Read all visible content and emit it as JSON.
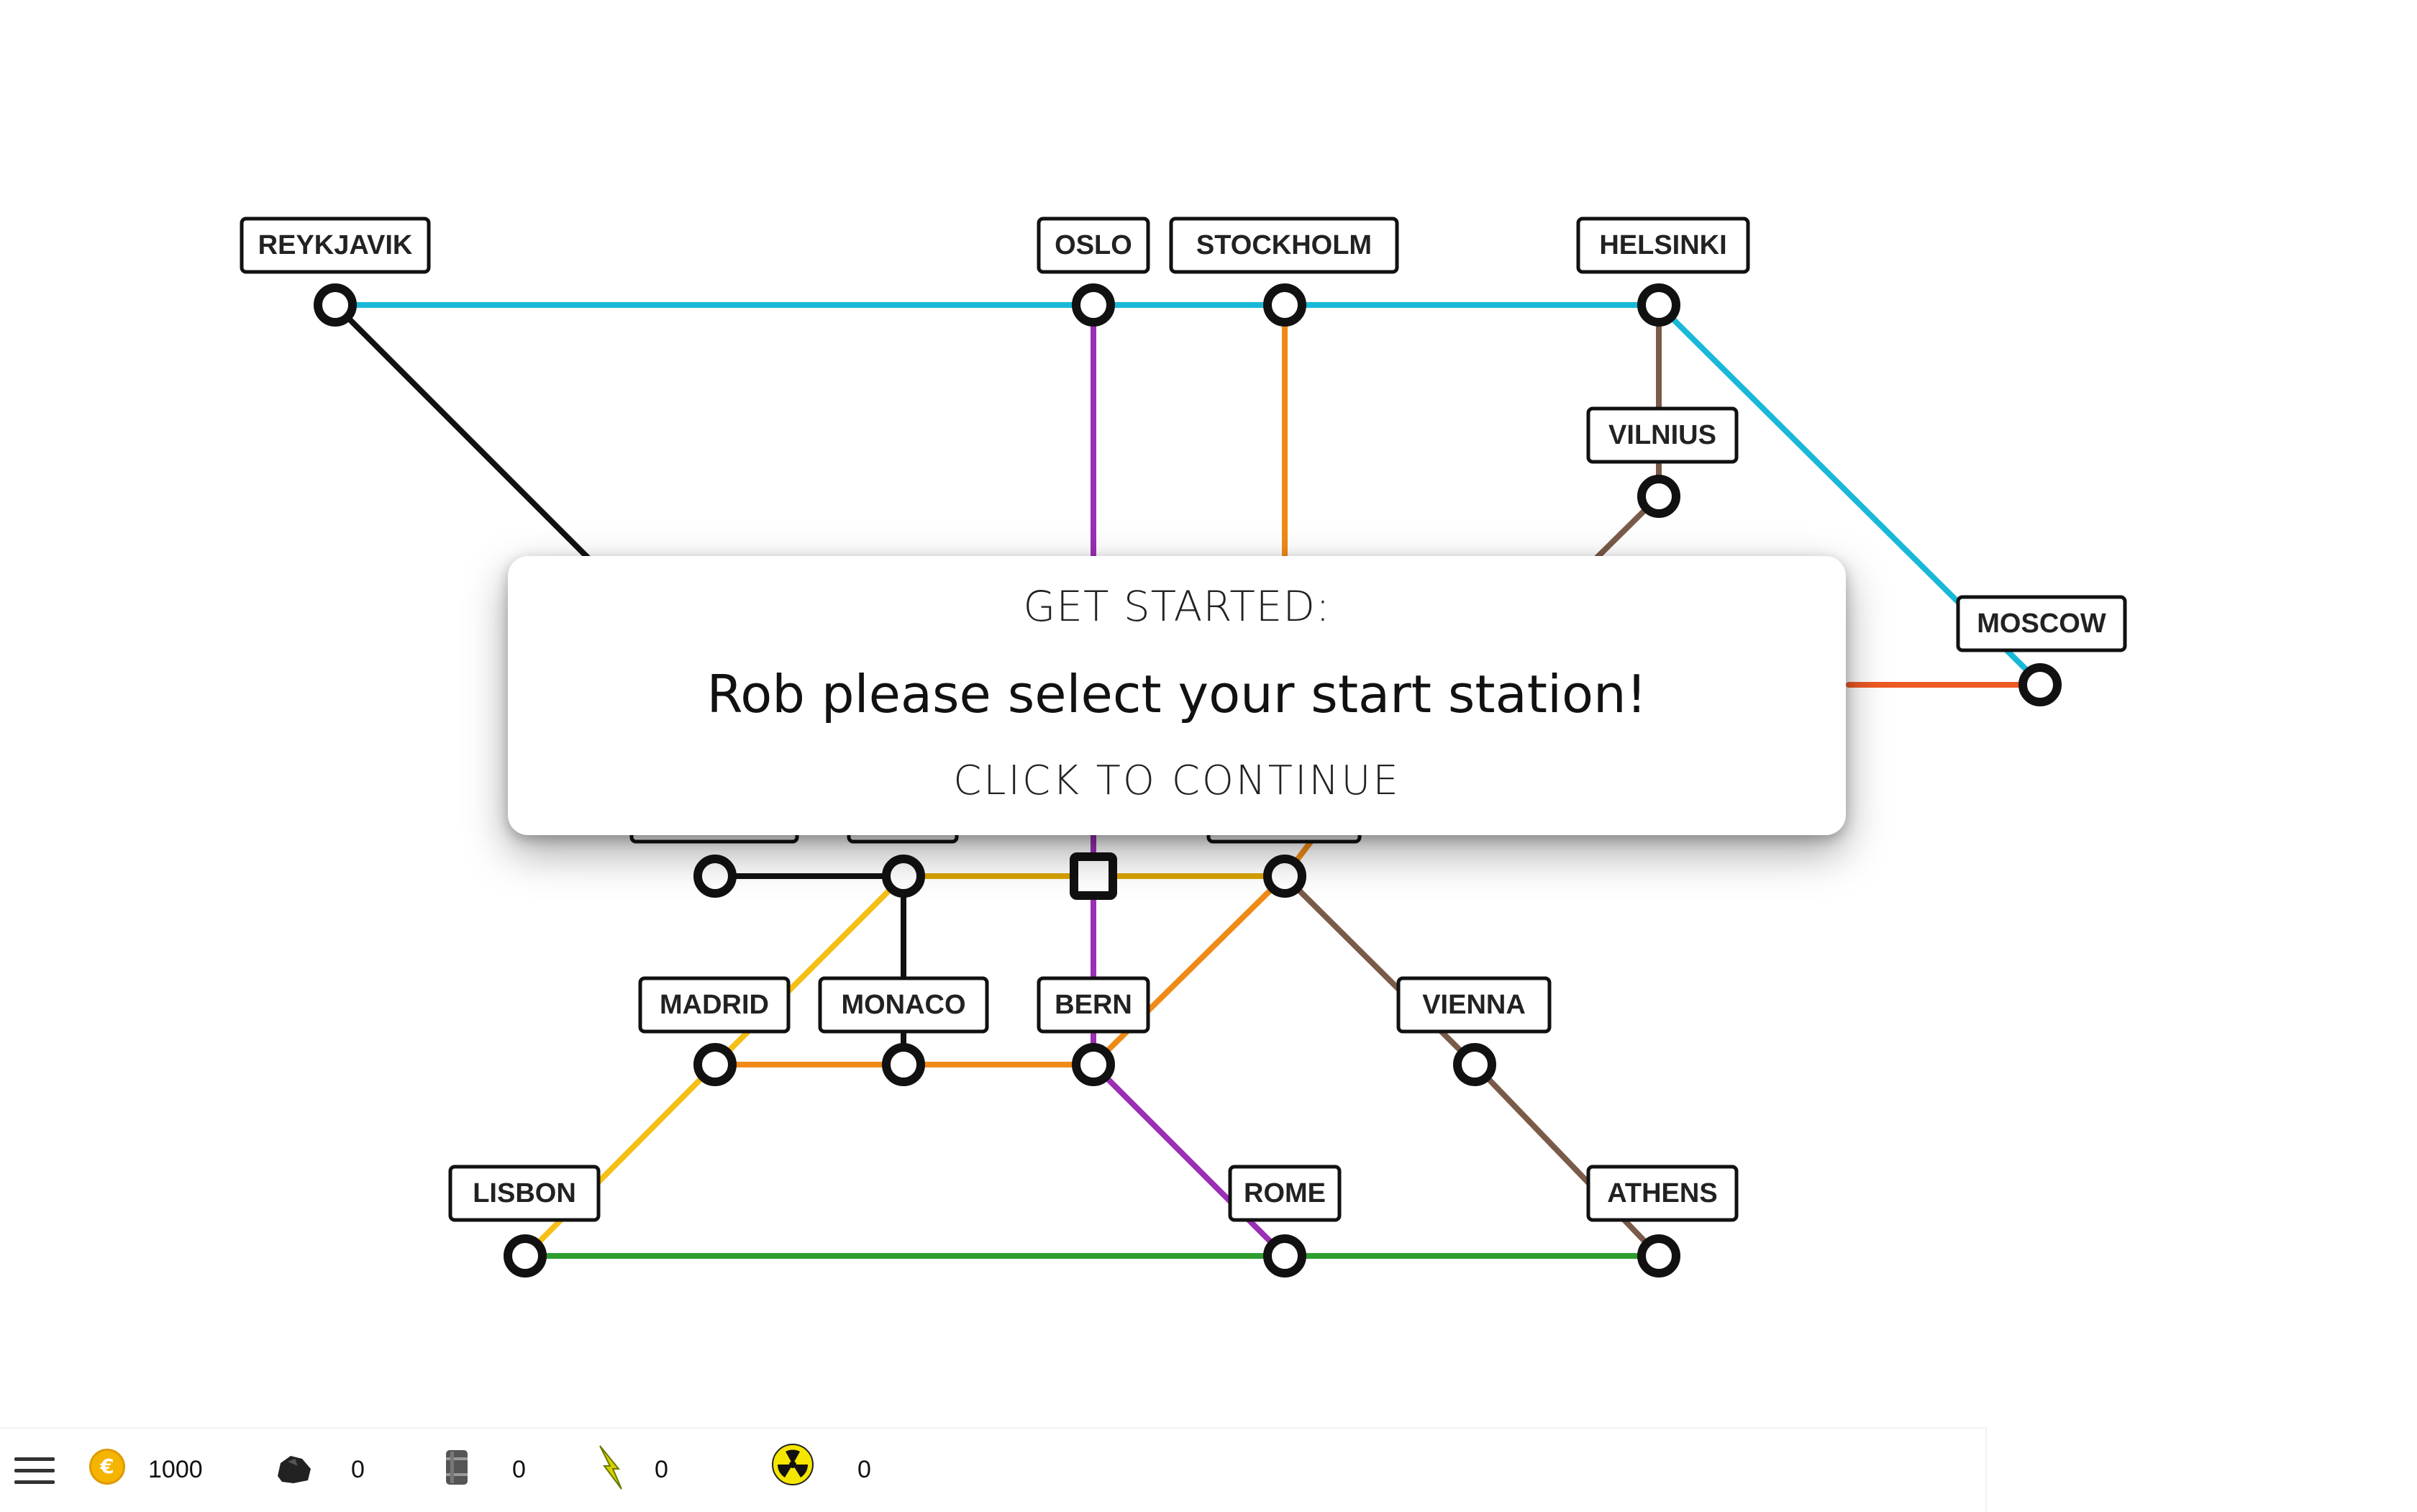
{
  "stations": {
    "reykjavik": "REYKJAVIK",
    "oslo": "OSLO",
    "stockholm": "STOCKHOLM",
    "helsinki": "HELSINKI",
    "vilnius": "VILNIUS",
    "moscow": "MOSCOW",
    "madrid": "MADRID",
    "monaco": "MONACO",
    "bern": "BERN",
    "vienna": "VIENNA",
    "lisbon": "LISBON",
    "rome": "ROME",
    "athens": "ATHENS"
  },
  "line_colors": {
    "cyan": "#1ab8d8",
    "black": "#111111",
    "purple": "#9b2fb5",
    "orange": "#ef8a17",
    "brown": "#7a5a48",
    "red_orange": "#ee5a24",
    "yellow": "#f5bf16",
    "gold": "#d9a400",
    "green": "#2f9e2f"
  },
  "modal": {
    "title": "GET STARTED:",
    "message": "Rob please select your start station!",
    "continue": "CLICK TO  CONTINUE"
  },
  "status_bar": {
    "coins": "1000",
    "coal": "0",
    "oil": "0",
    "electricity": "0",
    "nuclear": "0",
    "icons": [
      "menu-icon",
      "coin-icon",
      "coal-icon",
      "oil-barrel-icon",
      "lightning-icon",
      "radiation-icon"
    ]
  }
}
